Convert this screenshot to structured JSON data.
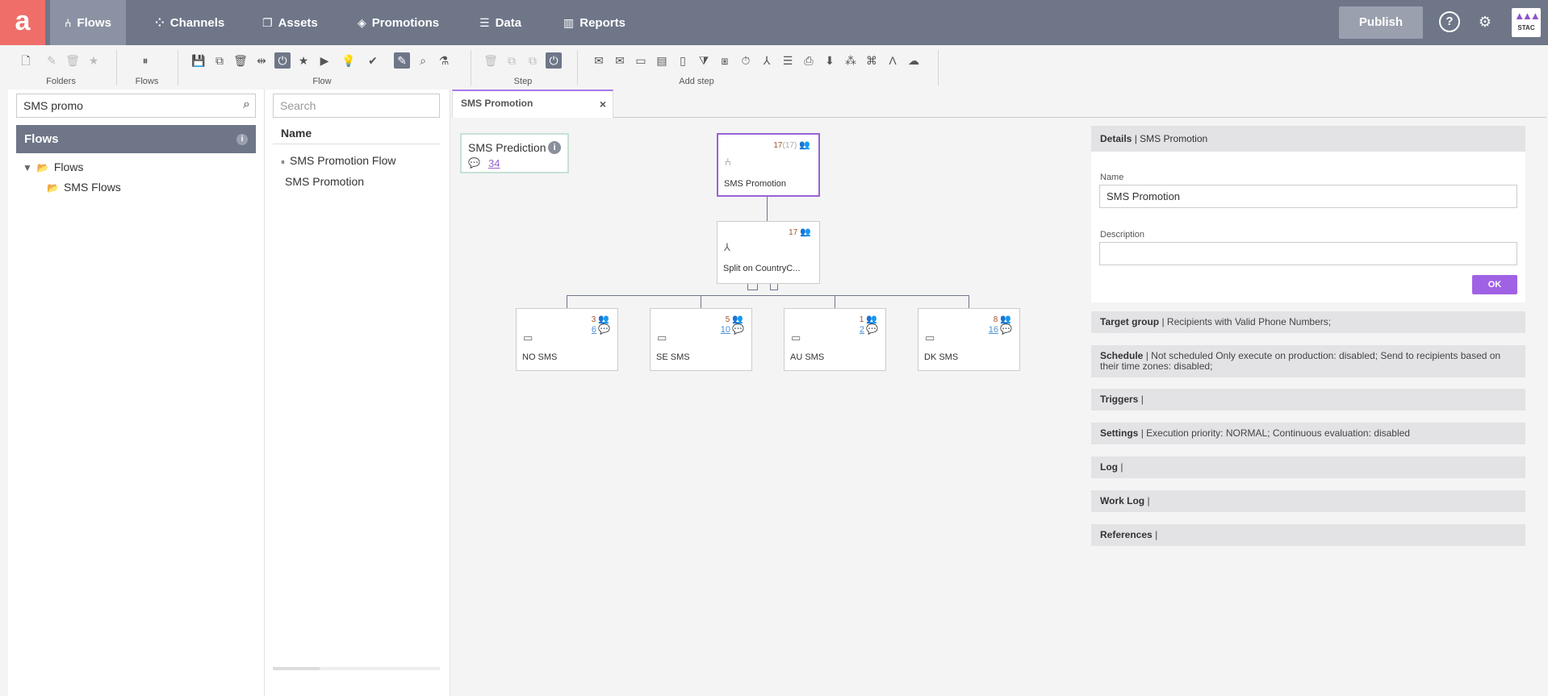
{
  "nav": {
    "logo": "a",
    "items": [
      {
        "label": "Flows",
        "icon": "⑃"
      },
      {
        "label": "Channels",
        "icon": "⁘"
      },
      {
        "label": "Assets",
        "icon": "❐"
      },
      {
        "label": "Promotions",
        "icon": "◈"
      },
      {
        "label": "Data",
        "icon": "☰"
      },
      {
        "label": "Reports",
        "icon": "▥"
      }
    ],
    "publish_label": "Publish",
    "help": "?",
    "settings": "⚙",
    "brand_text": "STAC"
  },
  "toolbar": {
    "groups": [
      "Folders",
      "Flows",
      "Flow",
      "Step",
      "Add step"
    ]
  },
  "left": {
    "search_value": "SMS promo",
    "section_title": "Flows",
    "info": "i",
    "tree": [
      "Flows",
      "SMS Flows"
    ]
  },
  "middle": {
    "search_placeholder": "Search",
    "column_header": "Name",
    "rows": [
      "SMS Promotion Flow",
      "SMS Promotion"
    ]
  },
  "canvas": {
    "tab_label": "SMS Promotion",
    "tab_close": "×",
    "prediction": {
      "title": "SMS Prediction",
      "count": "34"
    },
    "root": {
      "count": "17",
      "count_total": "(17)",
      "label": "SMS Promotion"
    },
    "split": {
      "count": "17",
      "label": "Split on CountryC..."
    },
    "branches": [
      {
        "count": "3",
        "sub": "6",
        "label": "NO SMS"
      },
      {
        "count": "5",
        "sub": "10",
        "label": "SE SMS"
      },
      {
        "count": "1",
        "sub": "2",
        "label": "AU SMS"
      },
      {
        "count": "8",
        "sub": "16",
        "label": "DK SMS"
      }
    ]
  },
  "details": {
    "header_bold": "Details",
    "header_rest": "| SMS Promotion",
    "name_label": "Name",
    "name_value": "SMS Promotion",
    "description_label": "Description",
    "description_value": "",
    "ok_label": "OK",
    "sections": [
      {
        "title": "Target group",
        "text": "| Recipients with Valid Phone Numbers;"
      },
      {
        "title": "Schedule",
        "text": "| Not scheduled Only execute on production: disabled; Send to recipients based on their time zones: disabled;"
      },
      {
        "title": "Triggers",
        "text": "|"
      },
      {
        "title": "Settings",
        "text": "| Execution priority: NORMAL; Continuous evaluation: disabled"
      },
      {
        "title": "Log",
        "text": "|"
      },
      {
        "title": "Work Log",
        "text": "|"
      },
      {
        "title": "References",
        "text": "|"
      }
    ]
  }
}
